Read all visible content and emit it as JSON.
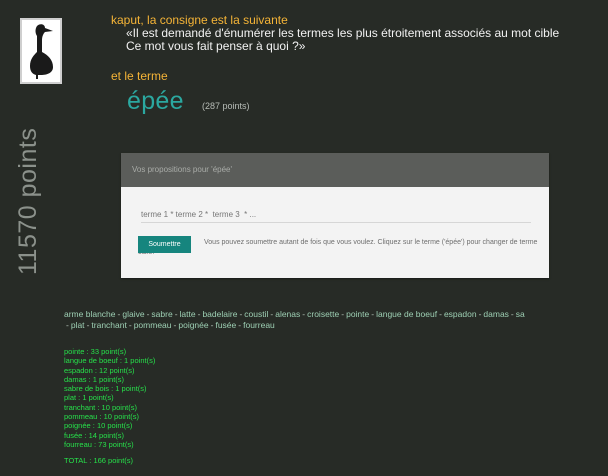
{
  "player": {
    "score_label": "11570 points"
  },
  "header": {
    "line1": "kaput, la consigne est la suivante",
    "line2": "«Il est demandé d'énumérer les termes les plus étroitement associés au mot cible",
    "line3": "Ce mot vous fait penser à quoi ?»",
    "line4": "et le terme"
  },
  "target": {
    "word": "épée",
    "points": "(287 points)"
  },
  "form": {
    "panel_title": "Vos propositions pour 'épée'",
    "input_placeholder": "terme 1 * terme 2 *  terme 3  * ...",
    "submit_label": "Soumettre",
    "help_text": "Vous pouvez soumettre autant de fois que vous voulez. Cliquez sur le terme ('épée') pour changer de terme cible."
  },
  "suggestions": {
    "line1": [
      "arme blanche",
      "glaive",
      "sabre",
      "latte",
      "badelaire",
      "coustil",
      "alenas",
      "croisette",
      "pointe",
      "langue de boeuf",
      "espadon",
      "damas",
      "sa"
    ],
    "line2": [
      "plat",
      "tranchant",
      "pommeau",
      "poignée",
      "fusée",
      "fourreau"
    ]
  },
  "results": [
    "pointe : 33 point(s)",
    "langue de boeuf : 1 point(s)",
    "espadon : 12 point(s)",
    "damas : 1 point(s)",
    "sabre de bois : 1 point(s)",
    "plat : 1 point(s)",
    "tranchant : 10 point(s)",
    "pommeau : 10 point(s)",
    "poignée : 10 point(s)",
    "fusée : 14 point(s)",
    "fourreau : 73 point(s)"
  ],
  "total": "TOTAL : 166 point(s)",
  "colors": {
    "background": "#272b26",
    "accent_orange": "#f5b437",
    "accent_teal": "#2ba8a0",
    "result_green": "#27e04a"
  }
}
